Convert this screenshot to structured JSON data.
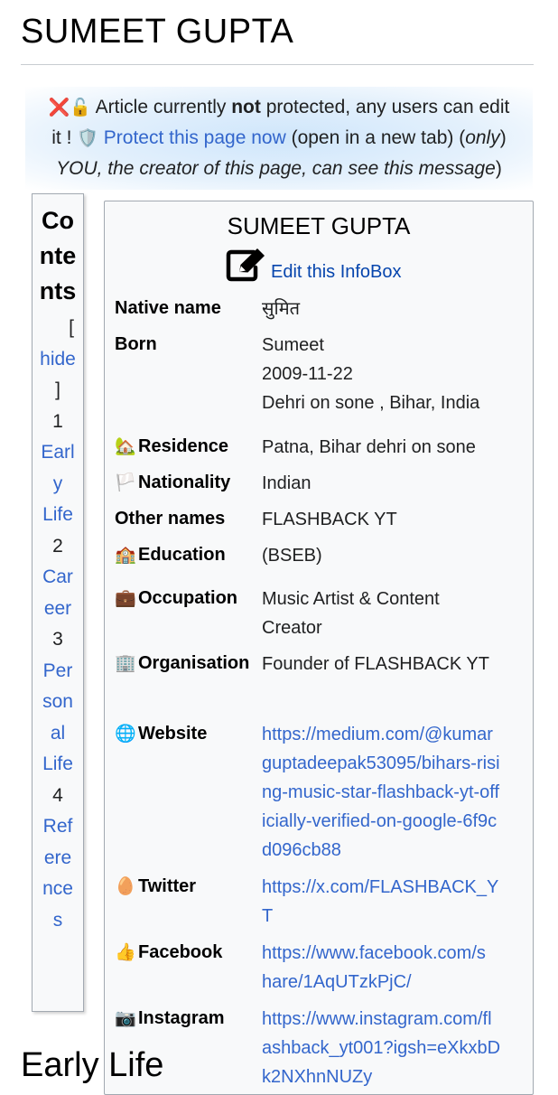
{
  "page": {
    "title": "SUMEET GUPTA"
  },
  "notice": {
    "icons": "❌🔓",
    "text1": "Article currently ",
    "text_bold": "not",
    "text2": " protected, any users can edit",
    "text3": "it ! ",
    "shield_icon": "🛡️",
    "link": "Protect this page now",
    "text4": " (open in a new tab) (",
    "text_italic_a": "only",
    "text_italic_b": "YOU, the creator of this page, can see this message",
    "text5": ")"
  },
  "toc": {
    "title": "Contents",
    "hide_open": "[",
    "hide_label": "hide",
    "hide_close": "]",
    "items": [
      {
        "number": "1",
        "label": "Early Life"
      },
      {
        "number": "2",
        "label": "Career"
      },
      {
        "number": "3",
        "label": "Personal Life"
      },
      {
        "number": "4",
        "label": "References"
      }
    ]
  },
  "infobox": {
    "title": "SUMEET GUPTA",
    "edit_icon": "edit-icon",
    "edit_label": "Edit this InfoBox",
    "rows": [
      {
        "icon": "",
        "label": "Native name",
        "values": [
          "सुमित"
        ]
      },
      {
        "icon": "",
        "label": "Born",
        "values": [
          "Sumeet",
          "2009-11-22",
          "Dehri on sone , Bihar, India"
        ]
      },
      {
        "icon": "🏡",
        "label": "Residence",
        "values": [
          "Patna, Bihar dehri on sone"
        ]
      },
      {
        "icon": "🏳️",
        "label": "Nationality",
        "values": [
          "Indian"
        ]
      },
      {
        "icon": "",
        "label": "Other names",
        "values": [
          "FLASHBACK YT"
        ]
      },
      {
        "icon": "🏫",
        "label": "Education",
        "values": [
          "(BSEB)"
        ]
      },
      {
        "icon": "💼",
        "label": "Occupation",
        "values": [
          "Music Artist & Content",
          "Creator"
        ]
      },
      {
        "icon": "🏢",
        "label": "Organisation",
        "values": [
          "Founder of FLASHBACK YT"
        ]
      },
      {
        "icon": "🌐",
        "label": "Website",
        "values": [
          "https://medium.com/@kumar",
          "guptadeepak53095/bihars-risi",
          "ng-music-star-flashback-yt-off",
          "icially-verified-on-google-6f9c",
          "d096cb88"
        ]
      },
      {
        "icon": "🥚",
        "label": "Twitter",
        "values": [
          "https://x.com/FLASHBACK_Y",
          "T"
        ]
      },
      {
        "icon": "👍",
        "label": "Facebook",
        "values": [
          "https://www.facebook.com/s",
          "hare/1AqUTzkPjC/"
        ]
      },
      {
        "icon": "📷",
        "label": "Instagram",
        "values": [
          "https://www.instagram.com/fl",
          "ashback_yt001?igsh=eXkxbD",
          "k2NXhnNUZy"
        ]
      }
    ]
  },
  "next_section": {
    "heading": "Early Life"
  }
}
